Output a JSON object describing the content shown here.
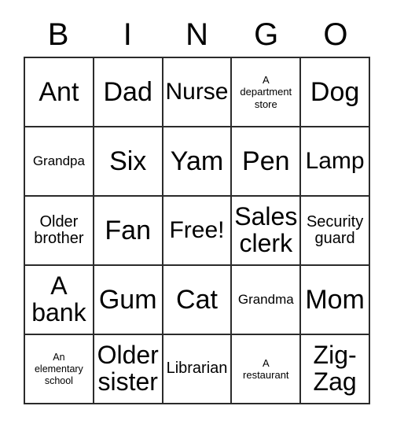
{
  "card": {
    "title": "BINGO",
    "header_letters": [
      "B",
      "I",
      "N",
      "G",
      "O"
    ],
    "grid_size": "5x5",
    "free_space_label": "Free!",
    "colors": {
      "border": "#2b2b2b",
      "background": "#ffffff",
      "text": "#000000"
    },
    "rows": [
      [
        {
          "text": "Ant",
          "size": "xl"
        },
        {
          "text": "Dad",
          "size": "xl"
        },
        {
          "text": "Nurse",
          "size": "md"
        },
        {
          "text": "A\ndepartment\nstore",
          "size": "xxs"
        },
        {
          "text": "Dog",
          "size": "xl"
        }
      ],
      [
        {
          "text": "Grandpa",
          "size": "xs"
        },
        {
          "text": "Six",
          "size": "xl"
        },
        {
          "text": "Yam",
          "size": "xl"
        },
        {
          "text": "Pen",
          "size": "xl"
        },
        {
          "text": "Lamp",
          "size": "md"
        }
      ],
      [
        {
          "text": "Older\nbrother",
          "size": "sm"
        },
        {
          "text": "Fan",
          "size": "xl"
        },
        {
          "text": "Free!",
          "size": "md"
        },
        {
          "text": "Sales\nclerk",
          "size": "lg"
        },
        {
          "text": "Security\nguard",
          "size": "sm"
        }
      ],
      [
        {
          "text": "A\nbank",
          "size": "lg"
        },
        {
          "text": "Gum",
          "size": "xl"
        },
        {
          "text": "Cat",
          "size": "xl"
        },
        {
          "text": "Grandma",
          "size": "xs"
        },
        {
          "text": "Mom",
          "size": "xl"
        }
      ],
      [
        {
          "text": "An\nelementary\nschool",
          "size": "tiny"
        },
        {
          "text": "Older\nsister",
          "size": "lg"
        },
        {
          "text": "Librarian",
          "size": "sm"
        },
        {
          "text": "A\nrestaurant",
          "size": "xxs"
        },
        {
          "text": "Zig-\nZag",
          "size": "lg"
        }
      ]
    ]
  }
}
